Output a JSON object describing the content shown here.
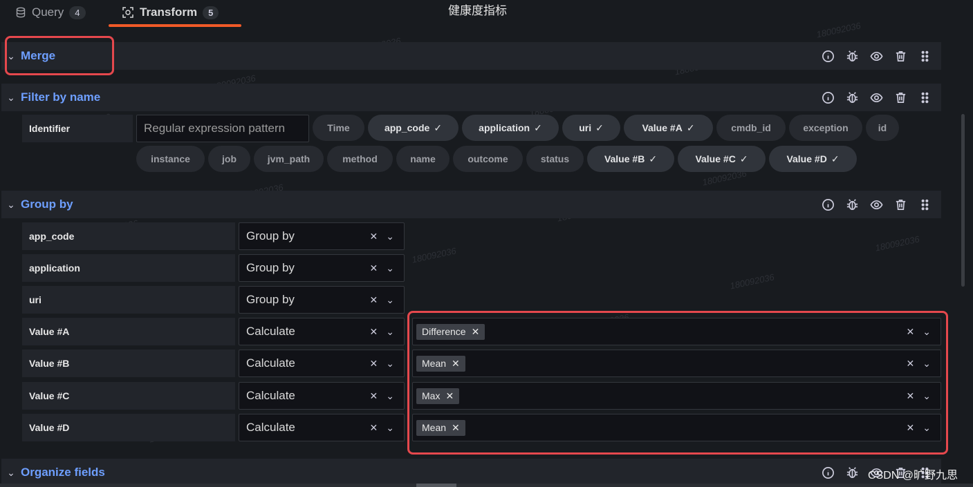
{
  "tabs": [
    {
      "label": "Query",
      "count": "4",
      "icon": "database-icon"
    },
    {
      "label": "Transform",
      "count": "5",
      "icon": "transform-icon"
    }
  ],
  "panel_title": "健康度指标",
  "sections": {
    "merge": {
      "title": "Merge"
    },
    "filter": {
      "title": "Filter by name",
      "identifier_label": "Identifier",
      "placeholder": "Regular expression pattern",
      "fields": [
        {
          "label": "Time",
          "selected": false
        },
        {
          "label": "app_code",
          "selected": true
        },
        {
          "label": "application",
          "selected": true
        },
        {
          "label": "uri",
          "selected": true
        },
        {
          "label": "Value #A",
          "selected": true
        },
        {
          "label": "cmdb_id",
          "selected": false
        },
        {
          "label": "exception",
          "selected": false
        },
        {
          "label": "id",
          "selected": false
        },
        {
          "label": "instance",
          "selected": false
        },
        {
          "label": "job",
          "selected": false
        },
        {
          "label": "jvm_path",
          "selected": false
        },
        {
          "label": "method",
          "selected": false
        },
        {
          "label": "name",
          "selected": false
        },
        {
          "label": "outcome",
          "selected": false
        },
        {
          "label": "status",
          "selected": false
        },
        {
          "label": "Value #B",
          "selected": true
        },
        {
          "label": "Value #C",
          "selected": true
        },
        {
          "label": "Value #D",
          "selected": true
        }
      ]
    },
    "groupby": {
      "title": "Group by",
      "rows": [
        {
          "field": "app_code",
          "mode": "Group by",
          "calc": ""
        },
        {
          "field": "application",
          "mode": "Group by",
          "calc": ""
        },
        {
          "field": "uri",
          "mode": "Group by",
          "calc": ""
        },
        {
          "field": "Value #A",
          "mode": "Calculate",
          "calc": "Difference"
        },
        {
          "field": "Value #B",
          "mode": "Calculate",
          "calc": "Mean"
        },
        {
          "field": "Value #C",
          "mode": "Calculate",
          "calc": "Max"
        },
        {
          "field": "Value #D",
          "mode": "Calculate",
          "calc": "Mean"
        }
      ]
    },
    "organize": {
      "title": "Organize fields"
    }
  },
  "glyphs": {
    "check": "✓",
    "clear": "✕",
    "chevron": "⌄",
    "chip_remove": "✕"
  },
  "watermark": "180092036",
  "footer_credit": "CSDN @旷野九思",
  "colors": {
    "accent": "#6e9fff",
    "highlight": "#e5484d",
    "tab_underline": "#f05a28"
  }
}
